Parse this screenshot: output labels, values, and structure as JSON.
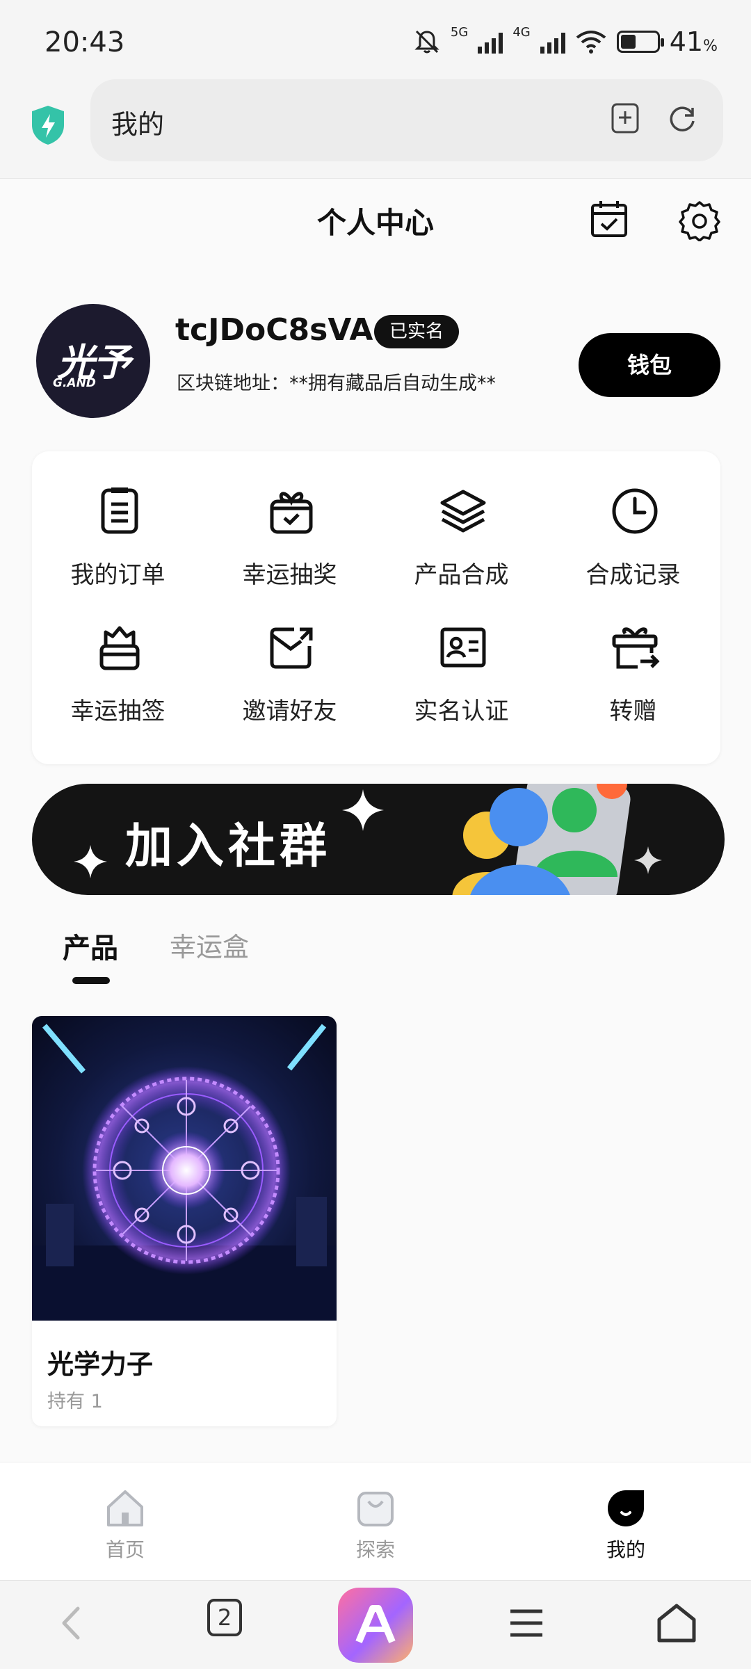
{
  "status_bar": {
    "time": "20:43",
    "network_1": "5G",
    "network_2": "4G",
    "battery_percent": "41",
    "battery_unit": "%",
    "battery_level": 0.41
  },
  "browser": {
    "address_text": "我的",
    "open_tab_count": "2"
  },
  "header": {
    "title": "个人中心"
  },
  "profile": {
    "avatar_main": "光予",
    "avatar_sub": "G.AND",
    "username": "tcJDoC8sVA",
    "verified_badge": "已实名",
    "chain_address": "区块链地址：**拥有藏品后自动生成**",
    "wallet_label": "钱包"
  },
  "menu": {
    "items": [
      {
        "label": "我的订单",
        "icon": "order-list-icon"
      },
      {
        "label": "幸运抽奖",
        "icon": "gift-icon"
      },
      {
        "label": "产品合成",
        "icon": "layers-icon"
      },
      {
        "label": "合成记录",
        "icon": "clock-icon"
      },
      {
        "label": "幸运抽签",
        "icon": "lottery-cup-icon"
      },
      {
        "label": "邀请好友",
        "icon": "invite-icon"
      },
      {
        "label": "实名认证",
        "icon": "id-card-icon"
      },
      {
        "label": "转赠",
        "icon": "transfer-gift-icon"
      }
    ]
  },
  "banner": {
    "text": "加入社群"
  },
  "tabs": {
    "products": "产品",
    "lucky_box": "幸运盒"
  },
  "products": [
    {
      "name": "光学力子",
      "held": "持有 1"
    }
  ],
  "bottom_nav": {
    "home": "首页",
    "explore": "探索",
    "mine": "我的"
  }
}
